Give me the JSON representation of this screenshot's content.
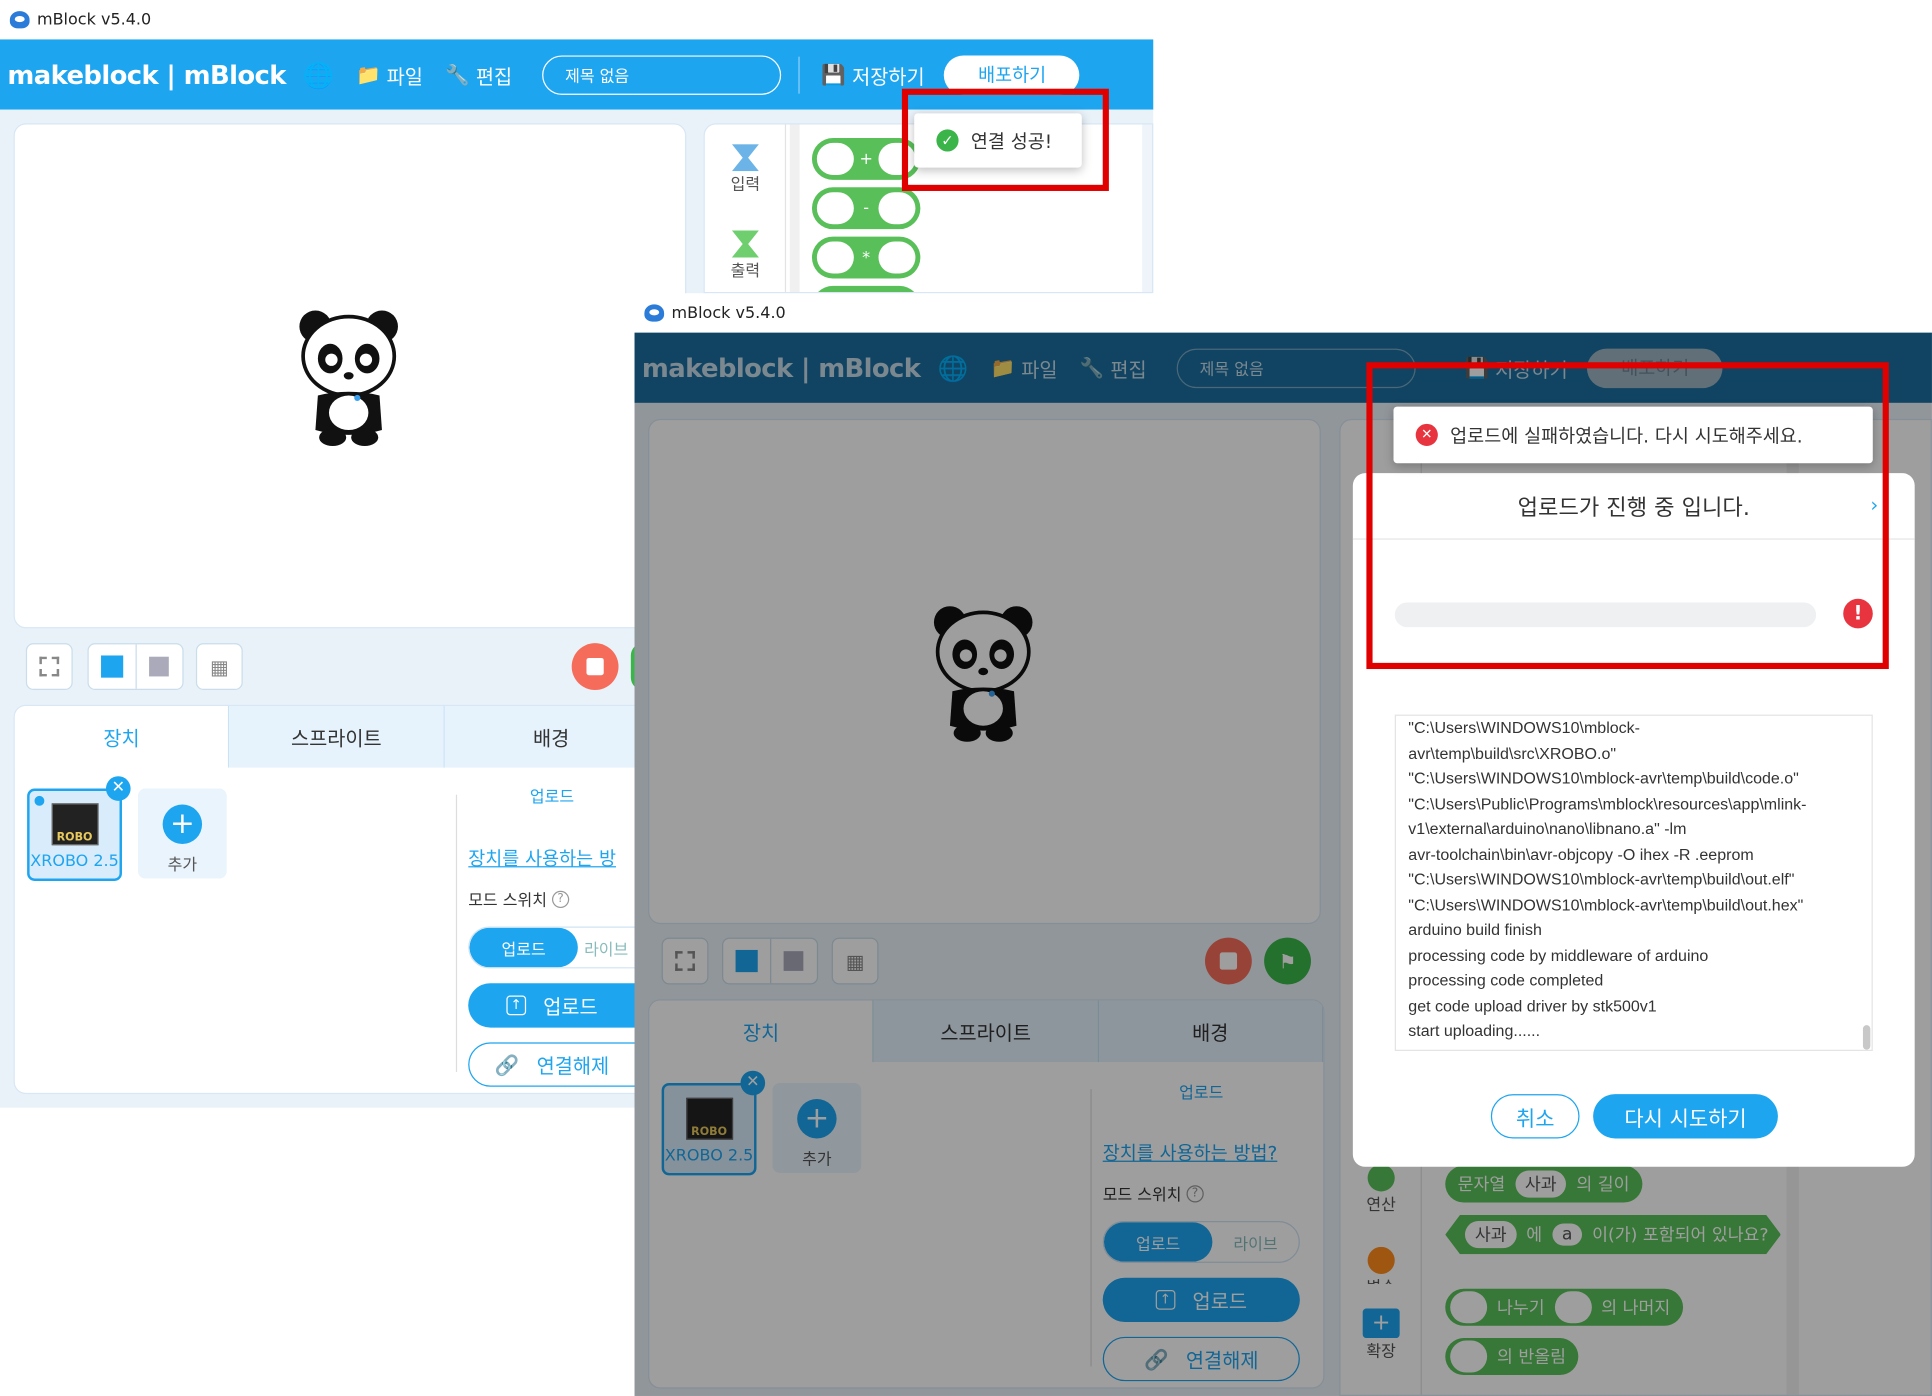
{
  "window1": {
    "title": "mBlock v5.4.0",
    "brand": "makeblock | mBlock",
    "menu_file": "파일",
    "menu_edit": "편집",
    "project_title": "제목 없음",
    "save_label": "저장하기",
    "publish_label": "배포하기",
    "toast": "연결 성공!",
    "categories": [
      "입력",
      "출력"
    ],
    "math_blocks": [
      "+",
      "-",
      "*"
    ],
    "tabs": [
      "장치",
      "스프라이트",
      "배경"
    ],
    "device_name": "XROBO 2.5",
    "device_logo": "ROBO",
    "add_label": "추가",
    "upload_section": "업로드",
    "help_link": "장치를 사용하는 방",
    "mode_label": "모드 스위치",
    "mode_upload": "업로드",
    "mode_live": "라이브",
    "upload_button": "업로드",
    "disconnect_button": "연결해제"
  },
  "window2": {
    "title": "mBlock v5.4.0",
    "brand": "makeblock | mBlock",
    "menu_file": "파일",
    "menu_edit": "편집",
    "project_title": "제목 없음",
    "save_label": "저장하기",
    "publish_label": "배포하기",
    "error_toast": "업로드에 실패하였습니다. 다시 시도해주세요.",
    "dialog_title": "업로드가 진행 중 입니다.",
    "progress": 0,
    "log_lines": [
      "\"C:\\Users\\WINDOWS10\\mblock-",
      "avr\\temp\\build\\src\\XROBO.o\"",
      "\"C:\\Users\\WINDOWS10\\mblock-avr\\temp\\build\\code.o\"",
      "\"C:\\Users\\Public\\Programs\\mblock\\resources\\app\\mlink-",
      "v1\\external\\arduino\\nano\\libnano.a\" -lm",
      "avr-toolchain\\bin\\avr-objcopy -O ihex -R .eeprom",
      "\"C:\\Users\\WINDOWS10\\mblock-avr\\temp\\build\\out.elf\"",
      "\"C:\\Users\\WINDOWS10\\mblock-avr\\temp\\build\\out.hex\"",
      "arduino build finish",
      "processing code by middleware of arduino",
      "processing code completed",
      "get code upload driver by stk500v1",
      "start uploading......"
    ],
    "cancel_button": "취소",
    "retry_button": "다시 시도하기",
    "tabs": [
      "장치",
      "스프라이트",
      "배경"
    ],
    "device_name": "XROBO 2.5",
    "device_logo": "ROBO",
    "add_label": "추가",
    "upload_section": "업로드",
    "help_link": "장치를 사용하는 방법?",
    "mode_label": "모드 스위치",
    "mode_upload": "업로드",
    "mode_live": "라이브",
    "upload_button": "업로드",
    "disconnect_button": "연결해제",
    "categories": [
      "연산",
      "변수",
      "확장"
    ],
    "block_string_length": [
      "문자열",
      "사과",
      "의 길이"
    ],
    "block_contains": [
      "사과",
      "에",
      "a",
      "이(가) 포함되어 있나요?"
    ],
    "block_mod": [
      "나누기",
      "의 나머지"
    ],
    "block_round": [
      "의 반올림"
    ]
  },
  "colors": {
    "accent": "#1ea5f0",
    "annotation": "#e00000",
    "success": "#3bb54a",
    "error": "#e8343f",
    "block_green": "#59c059"
  }
}
